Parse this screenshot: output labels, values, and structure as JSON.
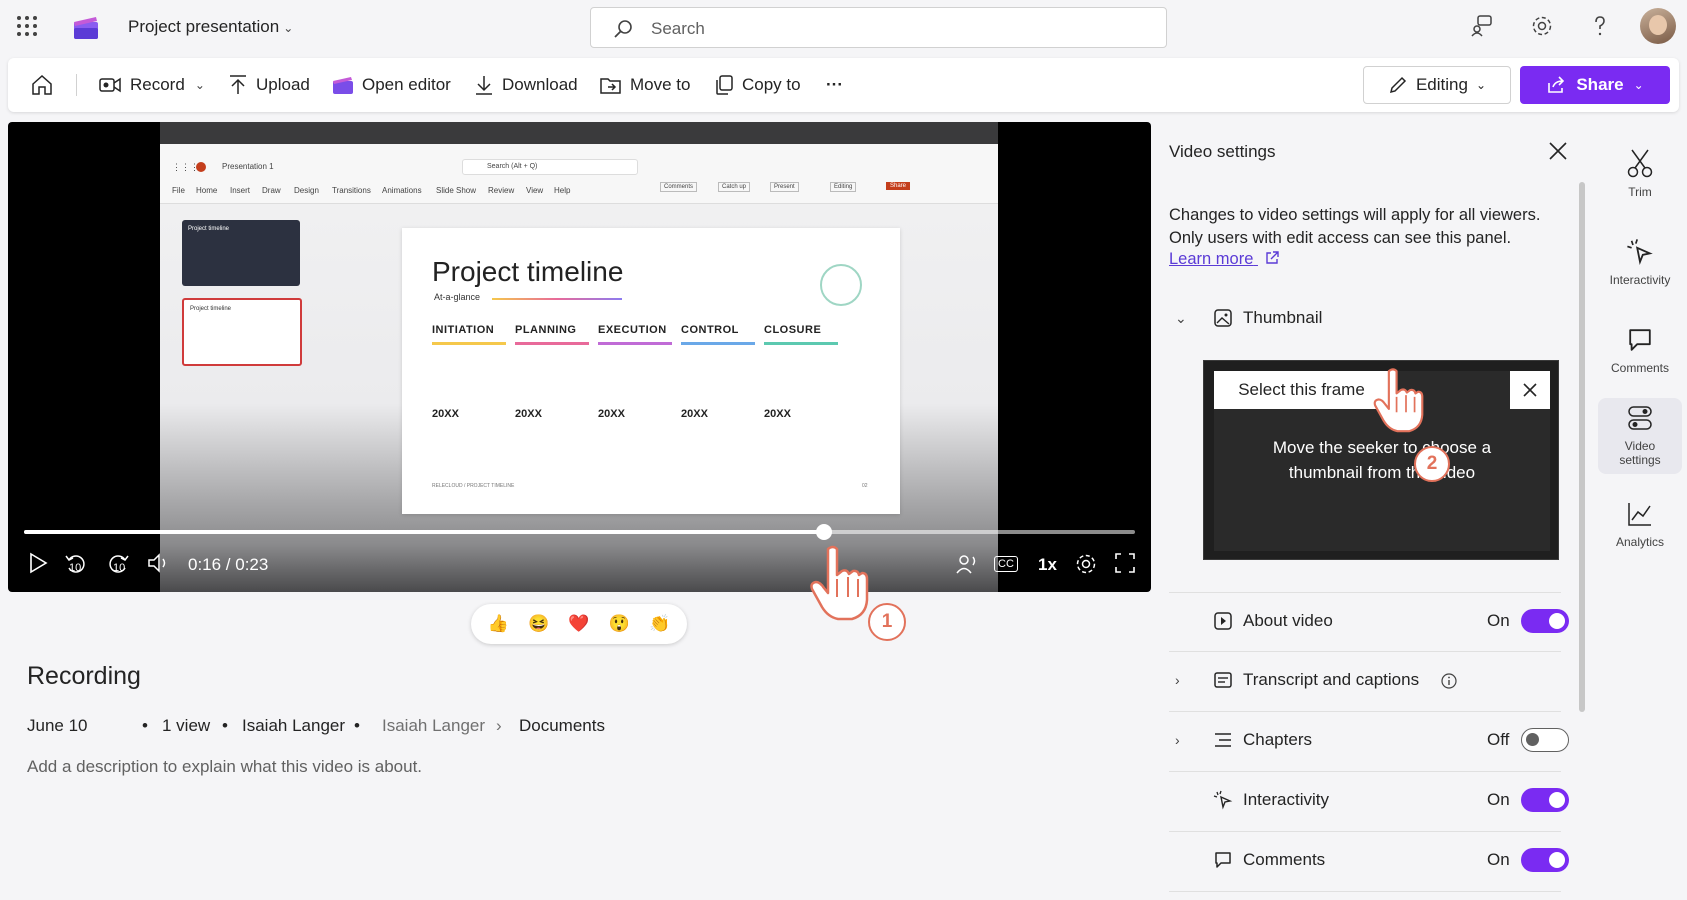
{
  "app": {
    "title": "Project presentation",
    "search_placeholder": "Search"
  },
  "toolbar": {
    "record": "Record",
    "upload": "Upload",
    "open_editor": "Open editor",
    "download": "Download",
    "move_to": "Move to",
    "copy_to": "Copy to",
    "more": "···",
    "editing": "Editing",
    "share": "Share"
  },
  "player": {
    "time": "0:16 / 0:23",
    "progress": 0.72,
    "skip_back": "10",
    "skip_forward": "10",
    "speed": "1x",
    "captions": "CC"
  },
  "slide": {
    "app_name": "Presentation 1",
    "search": "Search (Alt + Q)",
    "menu": [
      "File",
      "Home",
      "Insert",
      "Draw",
      "Design",
      "Transitions",
      "Animations",
      "Slide Show",
      "Review",
      "View",
      "Help"
    ],
    "actions": [
      "Comments",
      "Catch up",
      "Present",
      "Editing",
      "Share"
    ],
    "title": "Project timeline",
    "subtitle": "At-a-glance",
    "thumb_title": "Project timeline",
    "phases": [
      "INITIATION",
      "PLANNING",
      "EXECUTION",
      "CONTROL",
      "CLOSURE"
    ],
    "years": [
      "20XX",
      "20XX",
      "20XX",
      "20XX",
      "20XX"
    ],
    "footer": "RELECLOUD / PROJECT TIMELINE",
    "page": "02",
    "phase_colors": [
      "#f5c84b",
      "#e86a9a",
      "#c06bd6",
      "#6aa8e8",
      "#5cc9b0"
    ]
  },
  "reactions": [
    "👍",
    "😆",
    "❤️",
    "😲",
    "👏"
  ],
  "video": {
    "title": "Recording",
    "date": "June 10",
    "views": "1 view",
    "owner": "Isaiah Langer",
    "location_owner": "Isaiah Langer",
    "location_folder": "Documents",
    "description_placeholder": "Add a description to explain what this video is about."
  },
  "settings": {
    "title": "Video settings",
    "description": "Changes to video settings will apply for all viewers. Only users with edit access can see this panel.",
    "learn_more": "Learn more",
    "thumbnail": {
      "label": "Thumbnail",
      "select_frame": "Select this frame",
      "hint": "Move the seeker to choose a thumbnail from the video"
    },
    "sections": [
      {
        "label": "About video",
        "state": "On"
      },
      {
        "label": "Transcript and captions",
        "state": ""
      },
      {
        "label": "Chapters",
        "state": "Off"
      },
      {
        "label": "Interactivity",
        "state": "On"
      },
      {
        "label": "Comments",
        "state": "On"
      }
    ]
  },
  "rail": {
    "trim": "Trim",
    "interactivity": "Interactivity",
    "comments": "Comments",
    "video_settings": "Video settings",
    "analytics": "Analytics"
  },
  "pointers": {
    "one": "1",
    "two": "2"
  },
  "colors": {
    "accent": "#7a2bf2",
    "link": "#5b3bd6",
    "pointer": "#e2725b"
  }
}
